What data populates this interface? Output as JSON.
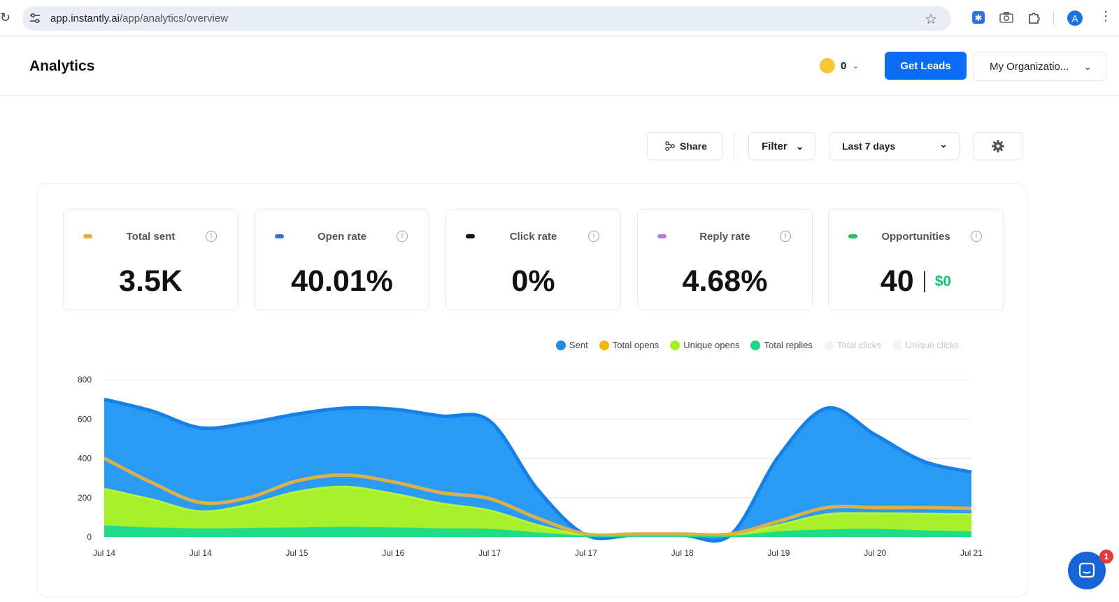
{
  "browser": {
    "url_host": "app.instantly.ai",
    "url_path": "/app/analytics/overview",
    "profile_initial": "A"
  },
  "header": {
    "title": "Analytics",
    "credits": "0",
    "get_leads_label": "Get Leads",
    "org_label": "My Organizatio..."
  },
  "toolbar": {
    "share_label": "Share",
    "filter_label": "Filter",
    "range_label": "Last 7 days"
  },
  "stats": [
    {
      "label": "Total sent",
      "value": "3.5K",
      "color": "#f0a63a"
    },
    {
      "label": "Open rate",
      "value": "40.01%",
      "color": "#3b6fe0"
    },
    {
      "label": "Click rate",
      "value": "0%",
      "color": "#111111"
    },
    {
      "label": "Reply rate",
      "value": "4.68%",
      "color": "#b77be6"
    },
    {
      "label": "Opportunities",
      "value": "40",
      "money": "$0",
      "color": "#22c55e"
    }
  ],
  "legend": [
    {
      "label": "Sent",
      "color": "#1a8cf0",
      "faded": false
    },
    {
      "label": "Total opens",
      "color": "#f5b800",
      "faded": false
    },
    {
      "label": "Unique opens",
      "color": "#aaee22",
      "faded": false
    },
    {
      "label": "Total replies",
      "color": "#1fd68a",
      "faded": false
    },
    {
      "label": "Total clicks",
      "color": "#f2f5f8",
      "faded": true
    },
    {
      "label": "Unique clicks",
      "color": "#eef6fb",
      "faded": true
    }
  ],
  "chart_data": {
    "type": "area",
    "x": [
      "Jul 14",
      "Jul 14",
      "Jul 15",
      "Jul 16",
      "Jul 17",
      "Jul 17",
      "Jul 18",
      "Jul 19",
      "Jul 20",
      "Jul 21"
    ],
    "x_values": [
      0,
      0.5,
      1,
      1.5,
      2,
      2.5,
      3,
      3.5,
      4,
      4.5,
      5,
      5.5,
      6,
      6.5,
      7,
      7.5,
      8,
      8.5,
      9
    ],
    "ylim": [
      0,
      800
    ],
    "yticks": [
      0,
      200,
      400,
      600,
      800
    ],
    "grid": true,
    "series": [
      {
        "name": "Sent",
        "color": "#2196f3",
        "values": [
          700,
          640,
          555,
          580,
          625,
          655,
          650,
          615,
          590,
          240,
          10,
          10,
          10,
          10,
          410,
          655,
          520,
          385,
          330
        ]
      },
      {
        "name": "Total opens",
        "color": "#e8b34a",
        "values": [
          400,
          275,
          175,
          200,
          285,
          315,
          280,
          225,
          195,
          95,
          15,
          15,
          15,
          15,
          80,
          150,
          150,
          150,
          145
        ]
      },
      {
        "name": "Unique opens",
        "color": "#a8f02a",
        "values": [
          245,
          190,
          130,
          165,
          230,
          255,
          220,
          170,
          135,
          60,
          10,
          10,
          10,
          10,
          60,
          115,
          120,
          118,
          115
        ]
      },
      {
        "name": "Total replies",
        "color": "#1fd68a",
        "values": [
          55,
          45,
          40,
          42,
          45,
          48,
          45,
          40,
          38,
          20,
          3,
          3,
          3,
          3,
          25,
          35,
          38,
          30,
          25
        ]
      }
    ]
  }
}
